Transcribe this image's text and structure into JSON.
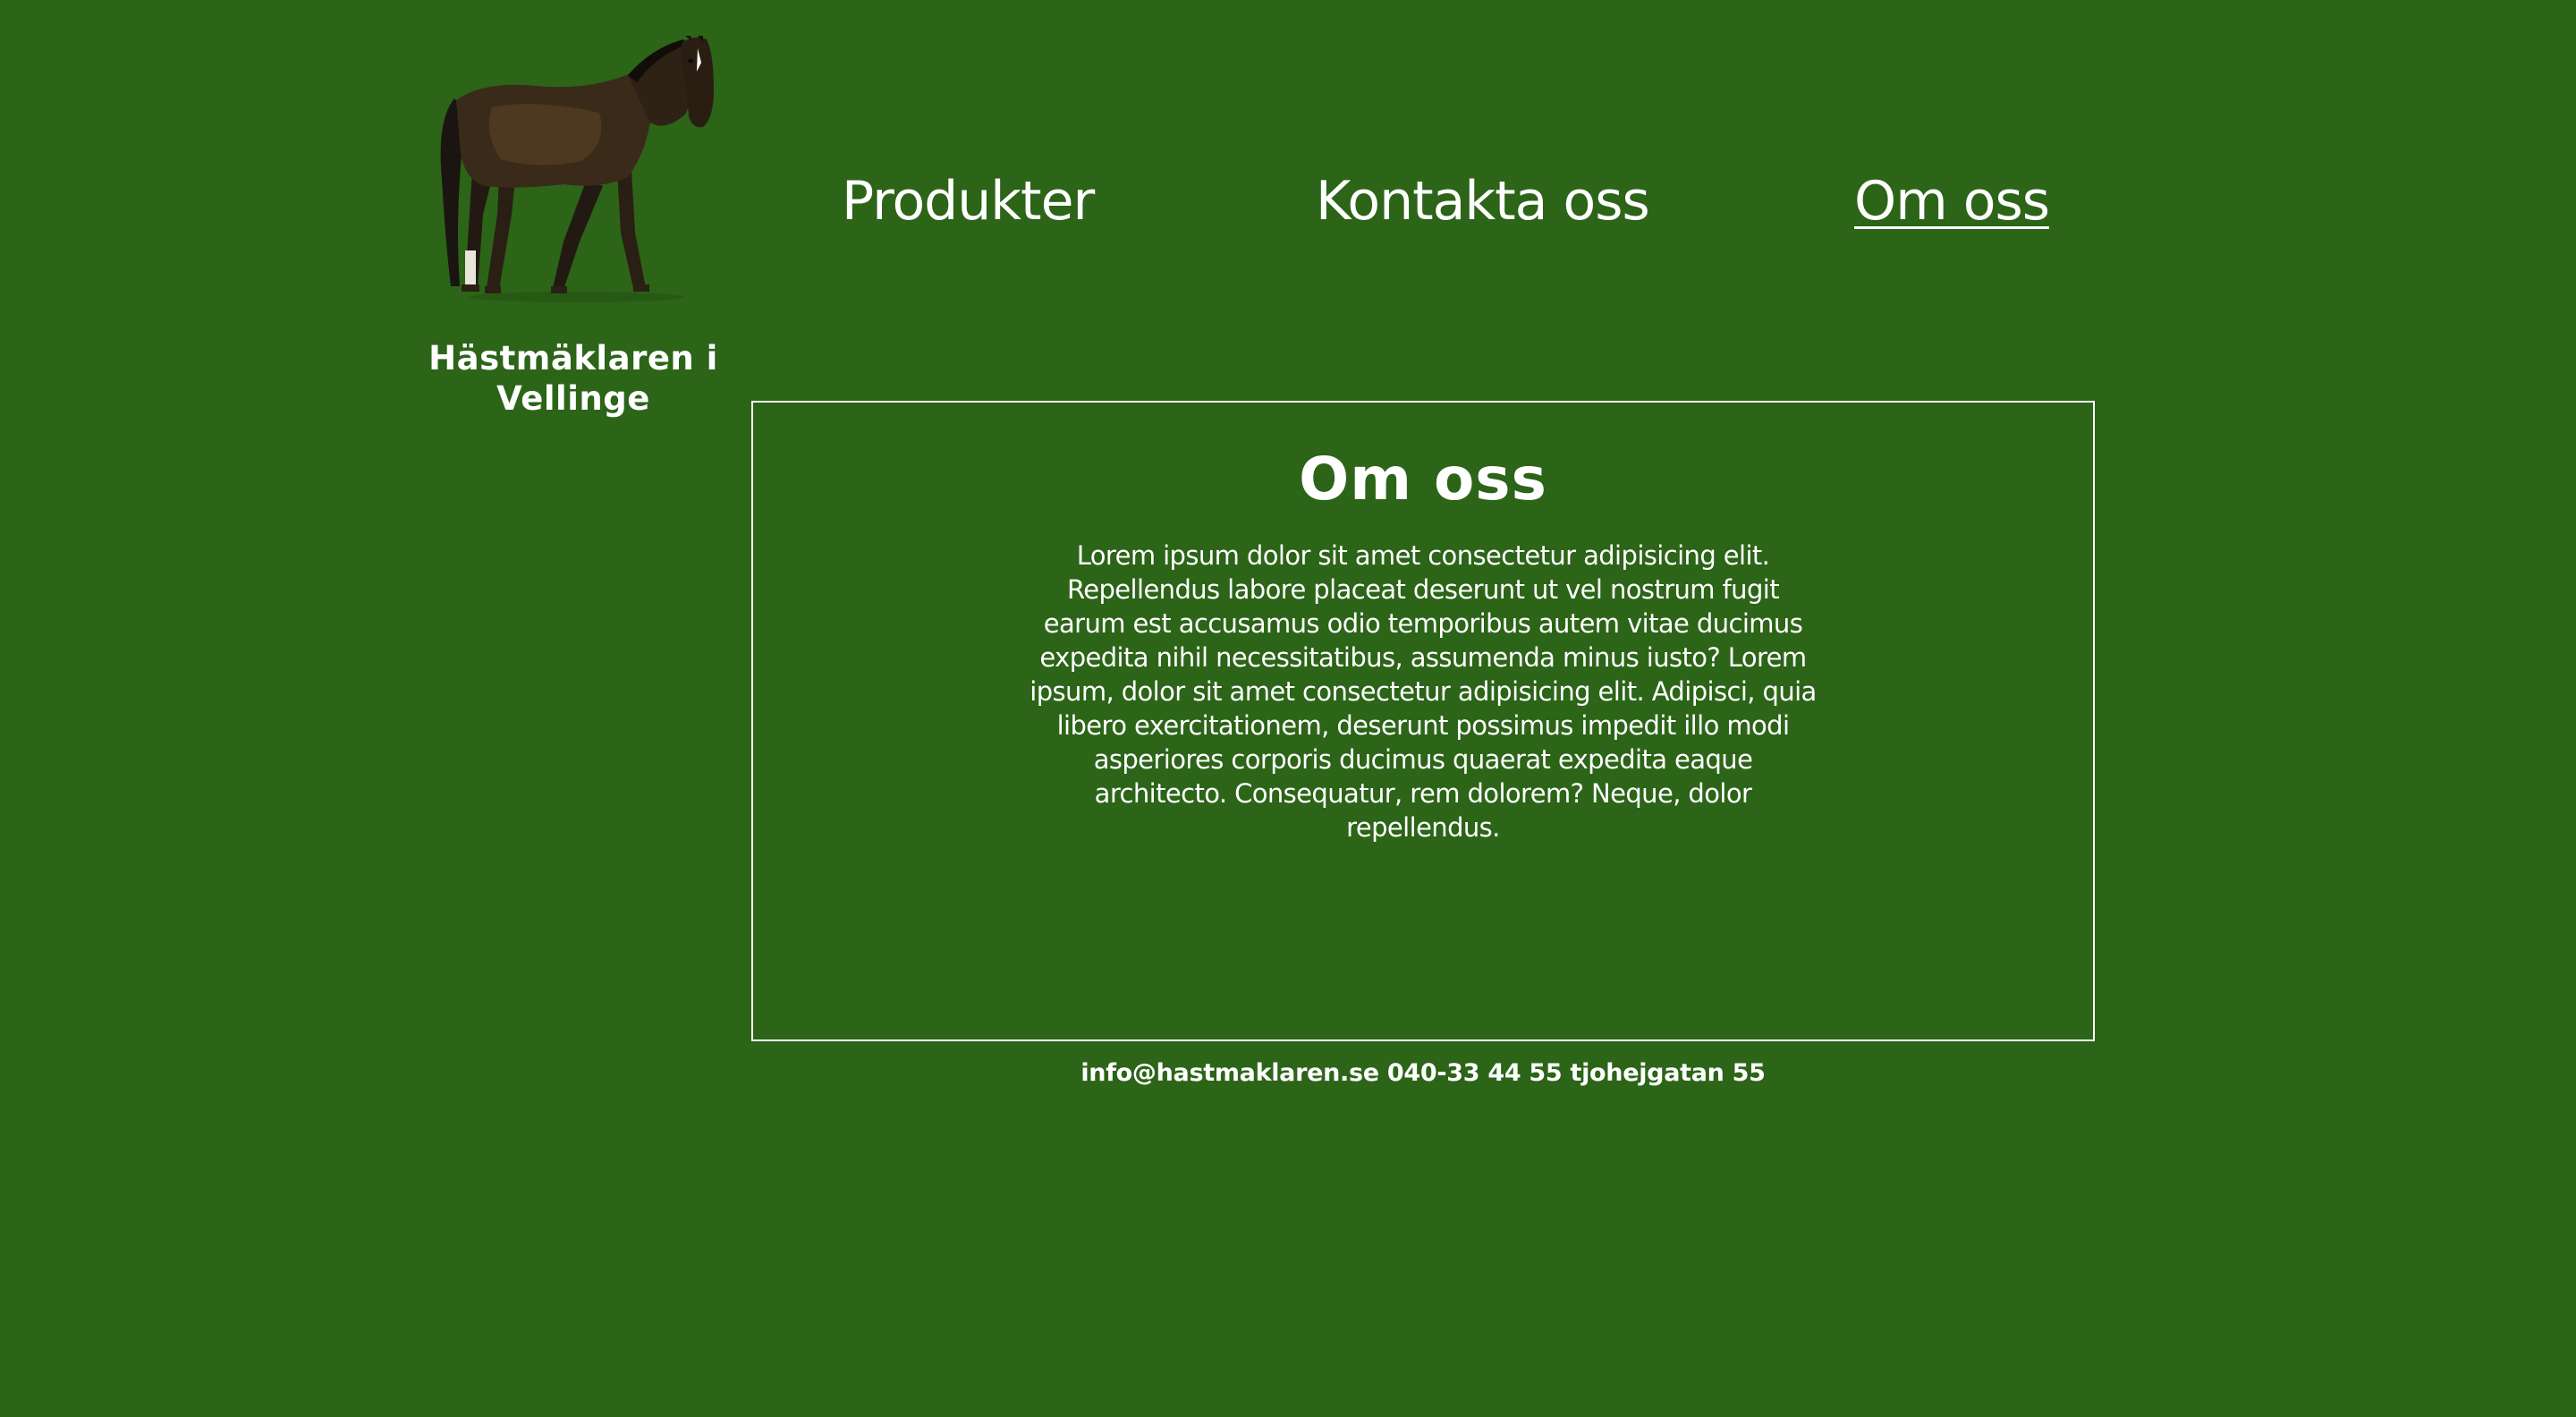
{
  "brand": {
    "name": "Hästmäklaren i Vellinge"
  },
  "nav": {
    "items": [
      {
        "label": "Produkter"
      },
      {
        "label": "Kontakta oss"
      },
      {
        "label": "Om oss",
        "active": true
      }
    ]
  },
  "main": {
    "title": "Om oss",
    "body": "Lorem ipsum dolor sit amet consectetur adipisicing elit. Repellendus labore placeat deserunt ut vel nostrum fugit earum est accusamus odio temporibus autem vitae ducimus expedita nihil necessitatibus, assumenda minus iusto? Lorem ipsum, dolor sit amet consectetur adipisicing elit. Adipisci, quia libero exercitationem, deserunt possimus impedit illo modi asperiores corporis ducimus quaerat expedita eaque architecto. Consequatur, rem dolorem? Neque, dolor repellendus."
  },
  "footer": {
    "contact": "info@hastmaklaren.se 040-33 44 55 tjohejgatan 55"
  },
  "colors": {
    "background": "#2c6418",
    "text": "#ffffff",
    "border": "#ffffff"
  },
  "icons": {
    "logo": "horse-logo-icon"
  }
}
